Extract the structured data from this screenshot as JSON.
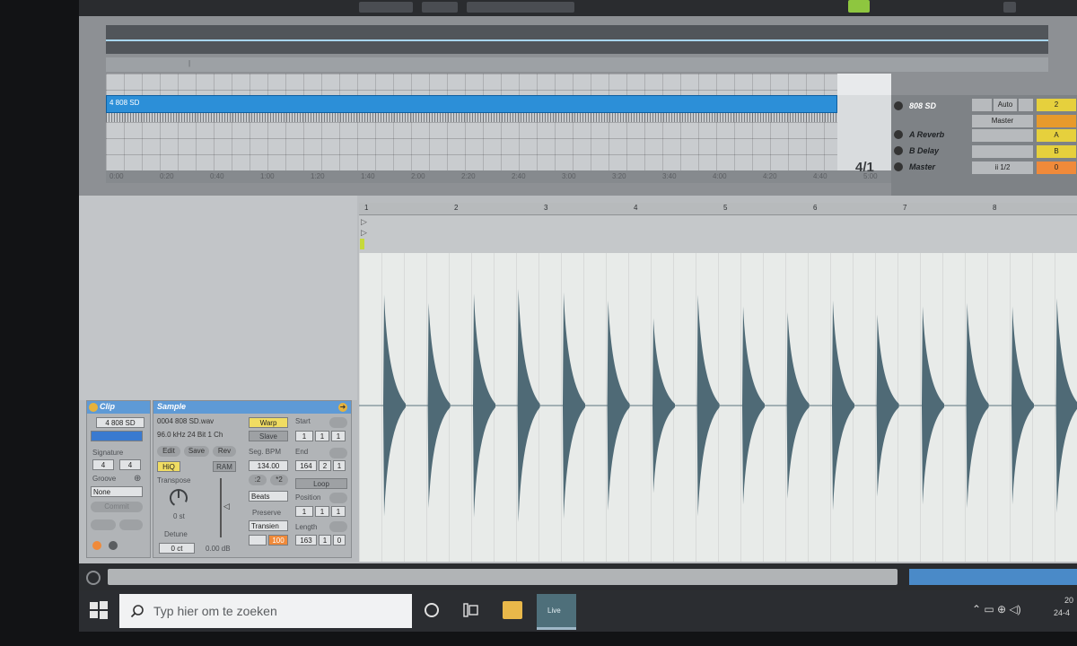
{
  "overview": {
    "track_clip_label": "4 808 SD",
    "time_ruler": [
      "0:00",
      "0:20",
      "0:40",
      "1:00",
      "1:20",
      "1:40",
      "2:00",
      "2:20",
      "2:40",
      "3:00",
      "3:20",
      "3:40",
      "4:00",
      "4:20",
      "4:40",
      "5:00"
    ],
    "position_readout": "4/1"
  },
  "mixer": {
    "tracks": [
      {
        "name": "808 SD",
        "color": "#4a90e2"
      },
      {
        "name": "A Reverb",
        "color": "#e8854d"
      },
      {
        "name": "B Delay",
        "color": "#e6d03d"
      },
      {
        "name": "Master",
        "color": "#f0a040"
      }
    ],
    "auto_label": "Auto",
    "io_master": "Master",
    "quantize": "ii 1/2",
    "sends": {
      "t1": "2",
      "a": "A",
      "b": "B",
      "master": "0"
    }
  },
  "clip_panel": {
    "title": "Clip",
    "clip_name": "4 808 SD",
    "signature_label": "Signature",
    "sig_num": "4",
    "sig_den": "4",
    "groove_label": "Groove",
    "groove_value": "None",
    "commit_label": "Commit"
  },
  "sample_panel": {
    "title": "Sample",
    "file_name": "0004 808 SD.wav",
    "file_info": "96.0 kHz 24 Bit 1 Ch",
    "edit_label": "Edit",
    "save_label": "Save",
    "rev_label": "Rev",
    "hiq_label": "HiQ",
    "ram_label": "RAM",
    "transpose_label": "Transpose",
    "transpose_value": "0 st",
    "detune_label": "Detune",
    "detune_value": "0 ct",
    "gain_value": "0.00 dB",
    "warp_label": "Warp",
    "slave_label": "Slave",
    "seg_bpm_label": "Seg. BPM",
    "seg_bpm_value": "134.00",
    "half_label": ":2",
    "double_label": "*2",
    "warp_mode": "Beats",
    "preserve_label": "Preserve",
    "preserve_value": "Transien",
    "loop_mode_value": "100",
    "start_label": "Start",
    "start_bar": "1",
    "start_beat": "1",
    "start_six": "1",
    "end_label": "End",
    "end_bar": "164",
    "end_beat": "2",
    "end_six": "1",
    "loop_label": "Loop",
    "position_label": "Position",
    "pos_bar": "1",
    "pos_beat": "1",
    "pos_six": "1",
    "length_label": "Length",
    "len_bar": "163",
    "len_beat": "1",
    "len_six": "0"
  },
  "waveform": {
    "bars": [
      "1",
      "2",
      "3",
      "4",
      "5",
      "6",
      "7",
      "8"
    ],
    "transients": [
      {
        "pos": 0.035,
        "height": 0.95
      },
      {
        "pos": 0.097,
        "height": 0.88
      },
      {
        "pos": 0.16,
        "height": 0.96
      },
      {
        "pos": 0.222,
        "height": 1.0
      },
      {
        "pos": 0.285,
        "height": 0.97
      },
      {
        "pos": 0.347,
        "height": 0.9
      },
      {
        "pos": 0.41,
        "height": 0.75
      },
      {
        "pos": 0.472,
        "height": 0.95
      },
      {
        "pos": 0.535,
        "height": 0.85
      },
      {
        "pos": 0.597,
        "height": 0.8
      },
      {
        "pos": 0.66,
        "height": 0.9
      },
      {
        "pos": 0.722,
        "height": 0.78
      },
      {
        "pos": 0.785,
        "height": 0.85
      },
      {
        "pos": 0.847,
        "height": 0.88
      },
      {
        "pos": 0.91,
        "height": 0.85
      },
      {
        "pos": 0.972,
        "height": 0.92
      }
    ]
  },
  "taskbar": {
    "search_placeholder": "Typ hier om te zoeken",
    "live_label": "Live",
    "clock_time": "20",
    "clock_date": "24-4"
  }
}
